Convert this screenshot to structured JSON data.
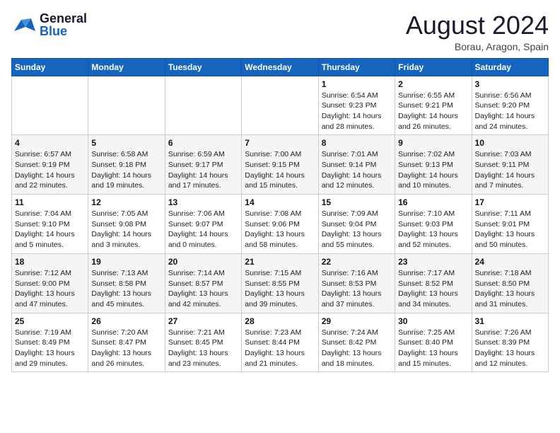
{
  "header": {
    "logo_general": "General",
    "logo_blue": "Blue",
    "title": "August 2024",
    "subtitle": "Borau, Aragon, Spain"
  },
  "weekdays": [
    "Sunday",
    "Monday",
    "Tuesday",
    "Wednesday",
    "Thursday",
    "Friday",
    "Saturday"
  ],
  "weeks": [
    [
      {
        "day": "",
        "info": ""
      },
      {
        "day": "",
        "info": ""
      },
      {
        "day": "",
        "info": ""
      },
      {
        "day": "",
        "info": ""
      },
      {
        "day": "1",
        "info": "Sunrise: 6:54 AM\nSunset: 9:23 PM\nDaylight: 14 hours\nand 28 minutes."
      },
      {
        "day": "2",
        "info": "Sunrise: 6:55 AM\nSunset: 9:21 PM\nDaylight: 14 hours\nand 26 minutes."
      },
      {
        "day": "3",
        "info": "Sunrise: 6:56 AM\nSunset: 9:20 PM\nDaylight: 14 hours\nand 24 minutes."
      }
    ],
    [
      {
        "day": "4",
        "info": "Sunrise: 6:57 AM\nSunset: 9:19 PM\nDaylight: 14 hours\nand 22 minutes."
      },
      {
        "day": "5",
        "info": "Sunrise: 6:58 AM\nSunset: 9:18 PM\nDaylight: 14 hours\nand 19 minutes."
      },
      {
        "day": "6",
        "info": "Sunrise: 6:59 AM\nSunset: 9:17 PM\nDaylight: 14 hours\nand 17 minutes."
      },
      {
        "day": "7",
        "info": "Sunrise: 7:00 AM\nSunset: 9:15 PM\nDaylight: 14 hours\nand 15 minutes."
      },
      {
        "day": "8",
        "info": "Sunrise: 7:01 AM\nSunset: 9:14 PM\nDaylight: 14 hours\nand 12 minutes."
      },
      {
        "day": "9",
        "info": "Sunrise: 7:02 AM\nSunset: 9:13 PM\nDaylight: 14 hours\nand 10 minutes."
      },
      {
        "day": "10",
        "info": "Sunrise: 7:03 AM\nSunset: 9:11 PM\nDaylight: 14 hours\nand 7 minutes."
      }
    ],
    [
      {
        "day": "11",
        "info": "Sunrise: 7:04 AM\nSunset: 9:10 PM\nDaylight: 14 hours\nand 5 minutes."
      },
      {
        "day": "12",
        "info": "Sunrise: 7:05 AM\nSunset: 9:08 PM\nDaylight: 14 hours\nand 3 minutes."
      },
      {
        "day": "13",
        "info": "Sunrise: 7:06 AM\nSunset: 9:07 PM\nDaylight: 14 hours\nand 0 minutes."
      },
      {
        "day": "14",
        "info": "Sunrise: 7:08 AM\nSunset: 9:06 PM\nDaylight: 13 hours\nand 58 minutes."
      },
      {
        "day": "15",
        "info": "Sunrise: 7:09 AM\nSunset: 9:04 PM\nDaylight: 13 hours\nand 55 minutes."
      },
      {
        "day": "16",
        "info": "Sunrise: 7:10 AM\nSunset: 9:03 PM\nDaylight: 13 hours\nand 52 minutes."
      },
      {
        "day": "17",
        "info": "Sunrise: 7:11 AM\nSunset: 9:01 PM\nDaylight: 13 hours\nand 50 minutes."
      }
    ],
    [
      {
        "day": "18",
        "info": "Sunrise: 7:12 AM\nSunset: 9:00 PM\nDaylight: 13 hours\nand 47 minutes."
      },
      {
        "day": "19",
        "info": "Sunrise: 7:13 AM\nSunset: 8:58 PM\nDaylight: 13 hours\nand 45 minutes."
      },
      {
        "day": "20",
        "info": "Sunrise: 7:14 AM\nSunset: 8:57 PM\nDaylight: 13 hours\nand 42 minutes."
      },
      {
        "day": "21",
        "info": "Sunrise: 7:15 AM\nSunset: 8:55 PM\nDaylight: 13 hours\nand 39 minutes."
      },
      {
        "day": "22",
        "info": "Sunrise: 7:16 AM\nSunset: 8:53 PM\nDaylight: 13 hours\nand 37 minutes."
      },
      {
        "day": "23",
        "info": "Sunrise: 7:17 AM\nSunset: 8:52 PM\nDaylight: 13 hours\nand 34 minutes."
      },
      {
        "day": "24",
        "info": "Sunrise: 7:18 AM\nSunset: 8:50 PM\nDaylight: 13 hours\nand 31 minutes."
      }
    ],
    [
      {
        "day": "25",
        "info": "Sunrise: 7:19 AM\nSunset: 8:49 PM\nDaylight: 13 hours\nand 29 minutes."
      },
      {
        "day": "26",
        "info": "Sunrise: 7:20 AM\nSunset: 8:47 PM\nDaylight: 13 hours\nand 26 minutes."
      },
      {
        "day": "27",
        "info": "Sunrise: 7:21 AM\nSunset: 8:45 PM\nDaylight: 13 hours\nand 23 minutes."
      },
      {
        "day": "28",
        "info": "Sunrise: 7:23 AM\nSunset: 8:44 PM\nDaylight: 13 hours\nand 21 minutes."
      },
      {
        "day": "29",
        "info": "Sunrise: 7:24 AM\nSunset: 8:42 PM\nDaylight: 13 hours\nand 18 minutes."
      },
      {
        "day": "30",
        "info": "Sunrise: 7:25 AM\nSunset: 8:40 PM\nDaylight: 13 hours\nand 15 minutes."
      },
      {
        "day": "31",
        "info": "Sunrise: 7:26 AM\nSunset: 8:39 PM\nDaylight: 13 hours\nand 12 minutes."
      }
    ]
  ]
}
